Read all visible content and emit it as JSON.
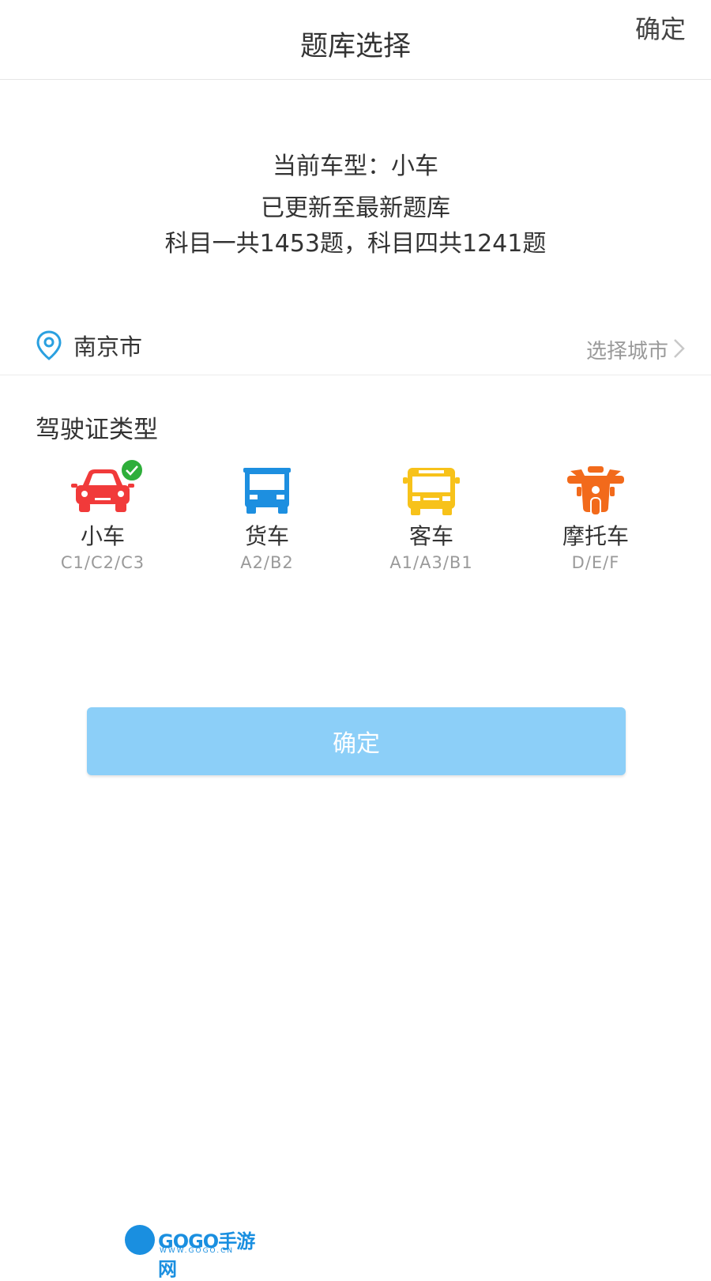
{
  "header": {
    "title": "题库选择",
    "confirm_label": "确定"
  },
  "info": {
    "current_type": "当前车型：小车",
    "update_status": "已更新至最新题库",
    "question_counts": "科目一共1453题，科目四共1241题"
  },
  "city": {
    "name": "南京市",
    "select_label": "选择城市"
  },
  "license": {
    "section_title": "驾驶证类型",
    "types": [
      {
        "name": "小车",
        "codes": "C1/C2/C3",
        "icon": "car-icon",
        "color": "#f13a3a",
        "selected": true
      },
      {
        "name": "货车",
        "codes": "A2/B2",
        "icon": "truck-icon",
        "color": "#1d8fe0",
        "selected": false
      },
      {
        "name": "客车",
        "codes": "A1/A3/B1",
        "icon": "bus-icon",
        "color": "#f7c21a",
        "selected": false
      },
      {
        "name": "摩托车",
        "codes": "D/E/F",
        "icon": "motorcycle-icon",
        "color": "#f26a1b",
        "selected": false
      }
    ]
  },
  "confirm_button": {
    "label": "确定",
    "color": "#8ccff8"
  },
  "watermark": {
    "text": "GOGO手游网",
    "sub": "WWW.GOGO.CN"
  }
}
